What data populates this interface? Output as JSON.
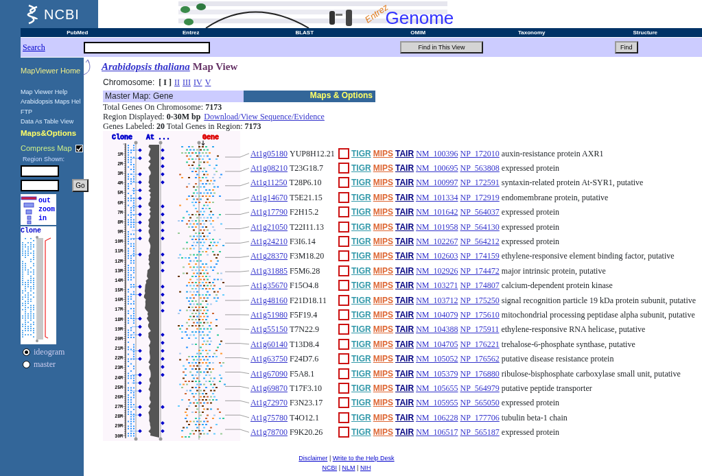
{
  "header": {
    "logo": "NCBI",
    "brand": "Entrez",
    "title": "Genome"
  },
  "nav": [
    "PubMed",
    "Entrez",
    "BLAST",
    "OMIM",
    "Taxonomy",
    "Structure"
  ],
  "search": {
    "link": "Search",
    "find_view_button": "Find in This View",
    "find_button": "Find"
  },
  "sidebar": {
    "home": "MapViewer Home",
    "links": [
      "Map Viewer Help",
      "Arabidopsis Maps Hel",
      "FTP",
      "Data As Table View"
    ],
    "section": "Maps&Options",
    "compress": {
      "label": "Compress Map",
      "checked": true
    },
    "region_label": "Region Shown:",
    "go_button": "Go",
    "zoom": [
      "out",
      "zoom",
      "in"
    ],
    "overview_label": "Clone",
    "views": [
      {
        "label": "ideogram",
        "selected": true
      },
      {
        "label": "master",
        "selected": false
      }
    ]
  },
  "page": {
    "title_link": "Arabidopsis thaliana",
    "title_rest": "Map View",
    "chromosome_label": "Chromosome:",
    "selected_marks": [
      "[",
      "]"
    ],
    "chromosomes": [
      {
        "label": "I",
        "selected": true
      },
      {
        "label": "II",
        "selected": false
      },
      {
        "label": "III",
        "selected": false
      },
      {
        "label": "IV",
        "selected": false
      },
      {
        "label": "V",
        "selected": false
      }
    ],
    "master_map": "Master Map: Gene",
    "options": "Maps & Options",
    "stats": [
      {
        "text": "Total Genes On Chromosome: **7173**"
      },
      {
        "text": "Region Displayed: **0-30M bp**",
        "link": "Download/View Sequence/Evidence"
      },
      {
        "text": "Genes Labeled: **20** Total Genes in Region: **7173**"
      }
    ]
  },
  "map": {
    "columns": [
      {
        "label": "Clone",
        "color": "#0000cc"
      },
      {
        "label": "At",
        "color": "#0000cc"
      },
      {
        "label": "...",
        "color": "#0000cc"
      },
      {
        "label": "Gene",
        "color": "#dd0000"
      }
    ],
    "ruler": [
      "1M",
      "2M",
      "3M",
      "4M",
      "5M",
      "6M",
      "7M",
      "8M",
      "9M",
      "10M",
      "11M",
      "12M",
      "13M",
      "14M",
      "15M",
      "16M",
      "17M",
      "18M",
      "19M",
      "20M",
      "21M",
      "22M",
      "23M",
      "24M",
      "25M",
      "26M",
      "27M",
      "28M",
      "29M",
      "30M"
    ]
  },
  "genes": [
    {
      "locus": "At1g05180",
      "clone": "YUP8H12.21",
      "checked": false,
      "db_links": [
        "TIGR",
        "MIPS",
        "TAIR"
      ],
      "nm": "NM_100396",
      "np": "NP_172010",
      "description": "auxin-resistance protein AXR1"
    },
    {
      "locus": "At1g08210",
      "clone": "T23G18.7",
      "checked": false,
      "db_links": [
        "TIGR",
        "MIPS",
        "TAIR"
      ],
      "nm": "NM_100695",
      "np": "NP_563808",
      "description": "expressed protein"
    },
    {
      "locus": "At1g11250",
      "clone": "T28P6.10",
      "checked": false,
      "db_links": [
        "TIGR",
        "MIPS",
        "TAIR"
      ],
      "nm": "NM_100997",
      "np": "NP_172591",
      "description": "syntaxin-related protein At-SYR1, putative"
    },
    {
      "locus": "At1g14670",
      "clone": "T5E21.15",
      "checked": false,
      "db_links": [
        "TIGR",
        "MIPS",
        "TAIR"
      ],
      "nm": "NM_101334",
      "np": "NP_172919",
      "description": "endomembrane protein, putative"
    },
    {
      "locus": "At1g17790",
      "clone": "F2H15.2",
      "checked": false,
      "db_links": [
        "TIGR",
        "MIPS",
        "TAIR"
      ],
      "nm": "NM_101642",
      "np": "NP_564037",
      "description": "expressed protein"
    },
    {
      "locus": "At1g21050",
      "clone": "T22I11.13",
      "checked": false,
      "db_links": [
        "TIGR",
        "MIPS",
        "TAIR"
      ],
      "nm": "NM_101958",
      "np": "NP_564130",
      "description": "expressed protein"
    },
    {
      "locus": "At1g24210",
      "clone": "F3I6.14",
      "checked": false,
      "db_links": [
        "TIGR",
        "MIPS",
        "TAIR"
      ],
      "nm": "NM_102267",
      "np": "NP_564212",
      "description": "expressed protein"
    },
    {
      "locus": "At1g28370",
      "clone": "F3M18.20",
      "checked": false,
      "db_links": [
        "TIGR",
        "MIPS",
        "TAIR"
      ],
      "nm": "NM_102603",
      "np": "NP_174159",
      "description": "ethylene-responsive element binding factor, putative"
    },
    {
      "locus": "At1g31885",
      "clone": "F5M6.28",
      "checked": false,
      "db_links": [
        "TIGR",
        "MIPS",
        "TAIR"
      ],
      "nm": "NM_102926",
      "np": "NP_174472",
      "description": "major intrinsic protein, putative"
    },
    {
      "locus": "At1g35670",
      "clone": "F15O4.8",
      "checked": false,
      "db_links": [
        "TIGR",
        "MIPS",
        "TAIR"
      ],
      "nm": "NM_103271",
      "np": "NP_174807",
      "description": "calcium-dependent protein kinase"
    },
    {
      "locus": "At1g48160",
      "clone": "F21D18.11",
      "checked": false,
      "db_links": [
        "TIGR",
        "MIPS",
        "TAIR"
      ],
      "nm": "NM_103712",
      "np": "NP_175250",
      "description": "signal recognition particle 19 kDa protein subunit, putative"
    },
    {
      "locus": "At1g51980",
      "clone": "F5F19.4",
      "checked": false,
      "db_links": [
        "TIGR",
        "MIPS",
        "TAIR"
      ],
      "nm": "NM_104079",
      "np": "NP_175610",
      "description": "mitochondrial processing peptidase alpha subunit, putative"
    },
    {
      "locus": "At1g55150",
      "clone": "T7N22.9",
      "checked": false,
      "db_links": [
        "TIGR",
        "MIPS",
        "TAIR"
      ],
      "nm": "NM_104388",
      "np": "NP_175911",
      "description": "ethylene-responsive RNA helicase, putative"
    },
    {
      "locus": "At1g60140",
      "clone": "T13D8.4",
      "checked": false,
      "db_links": [
        "TIGR",
        "MIPS",
        "TAIR"
      ],
      "nm": "NM_104705",
      "np": "NP_176221",
      "description": "trehalose-6-phosphate synthase, putative"
    },
    {
      "locus": "At1g63750",
      "clone": "F24D7.6",
      "checked": false,
      "db_links": [
        "TIGR",
        "MIPS",
        "TAIR"
      ],
      "nm": "NM_105052",
      "np": "NP_176562",
      "description": "putative disease resistance protein"
    },
    {
      "locus": "At1g67090",
      "clone": "F5A8.1",
      "checked": false,
      "db_links": [
        "TIGR",
        "MIPS",
        "TAIR"
      ],
      "nm": "NM_105379",
      "np": "NP_176880",
      "description": "ribulose-bisphosphate carboxylase small unit, putative"
    },
    {
      "locus": "At1g69870",
      "clone": "T17F3.10",
      "checked": false,
      "db_links": [
        "TIGR",
        "MIPS",
        "TAIR"
      ],
      "nm": "NM_105655",
      "np": "NP_564979",
      "description": "putative peptide transporter"
    },
    {
      "locus": "At1g72970",
      "clone": "F3N23.17",
      "checked": false,
      "db_links": [
        "TIGR",
        "MIPS",
        "TAIR"
      ],
      "nm": "NM_105955",
      "np": "NP_565050",
      "description": "expressed protein"
    },
    {
      "locus": "At1g75780",
      "clone": "T4O12.1",
      "checked": false,
      "db_links": [
        "TIGR",
        "MIPS",
        "TAIR"
      ],
      "nm": "NM_106228",
      "np": "NP_177706",
      "description": "tubulin beta-1 chain"
    },
    {
      "locus": "At1g78700",
      "clone": "F9K20.26",
      "checked": false,
      "db_links": [
        "TIGR",
        "MIPS",
        "TAIR"
      ],
      "nm": "NM_106517",
      "np": "NP_565187",
      "description": "expressed protein"
    }
  ],
  "footer": [
    {
      "links": [
        "Disclaimer",
        "Write to the Help Desk"
      ],
      "separator": "|"
    },
    {
      "links": [
        "NCBI",
        "NLM",
        "NIH"
      ],
      "separator": "|"
    }
  ]
}
